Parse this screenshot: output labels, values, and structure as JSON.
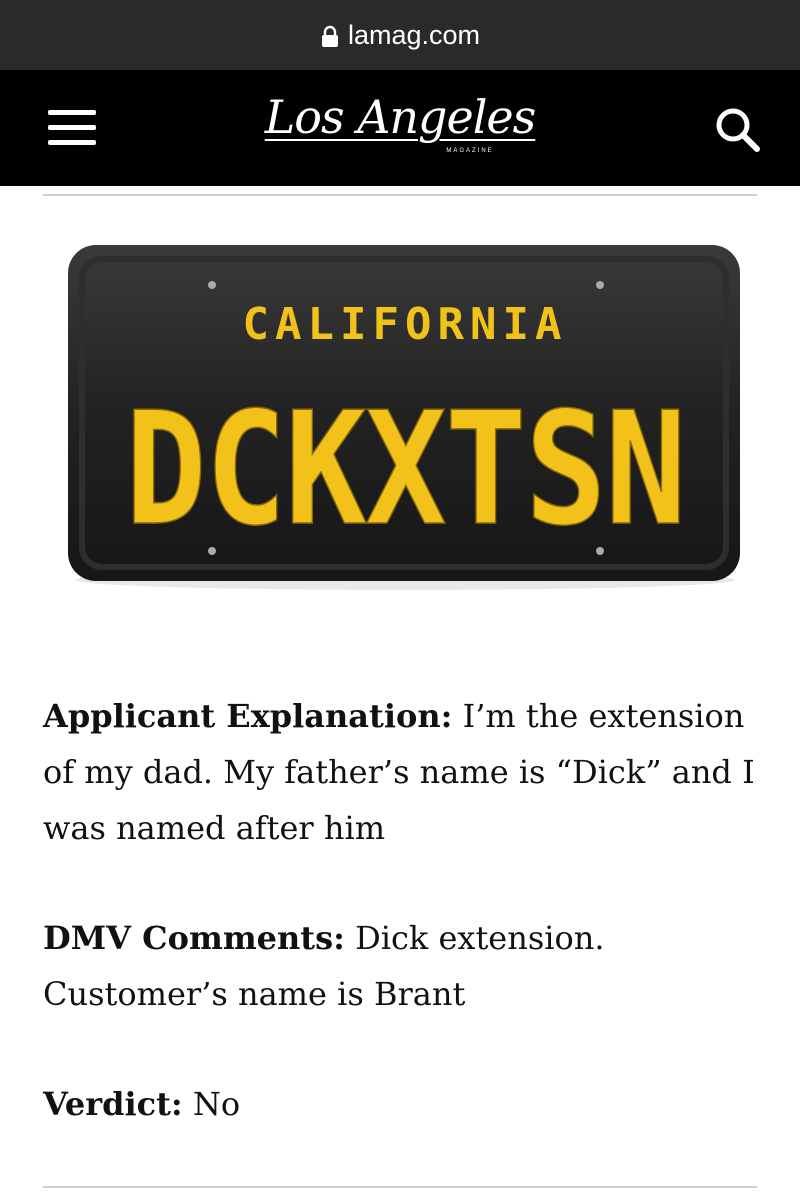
{
  "browser": {
    "url": "lamag.com"
  },
  "header": {
    "logo_text": "Los Angeles",
    "logo_sub": "MAGAZINE"
  },
  "plate": {
    "state": "CALIFORNIA",
    "text": "DCKXTSN",
    "background_color": "#1e1e1e",
    "text_color": "#f2c21a"
  },
  "article": {
    "items": [
      {
        "label": "Applicant Explanation:",
        "text": " I’m the extension of my dad. My father’s name is “Dick” and I was named after him"
      },
      {
        "label": "DMV Comments:",
        "text": " Dick extension. Customer’s name is Brant"
      },
      {
        "label": "Verdict:",
        "text": " No"
      }
    ]
  }
}
